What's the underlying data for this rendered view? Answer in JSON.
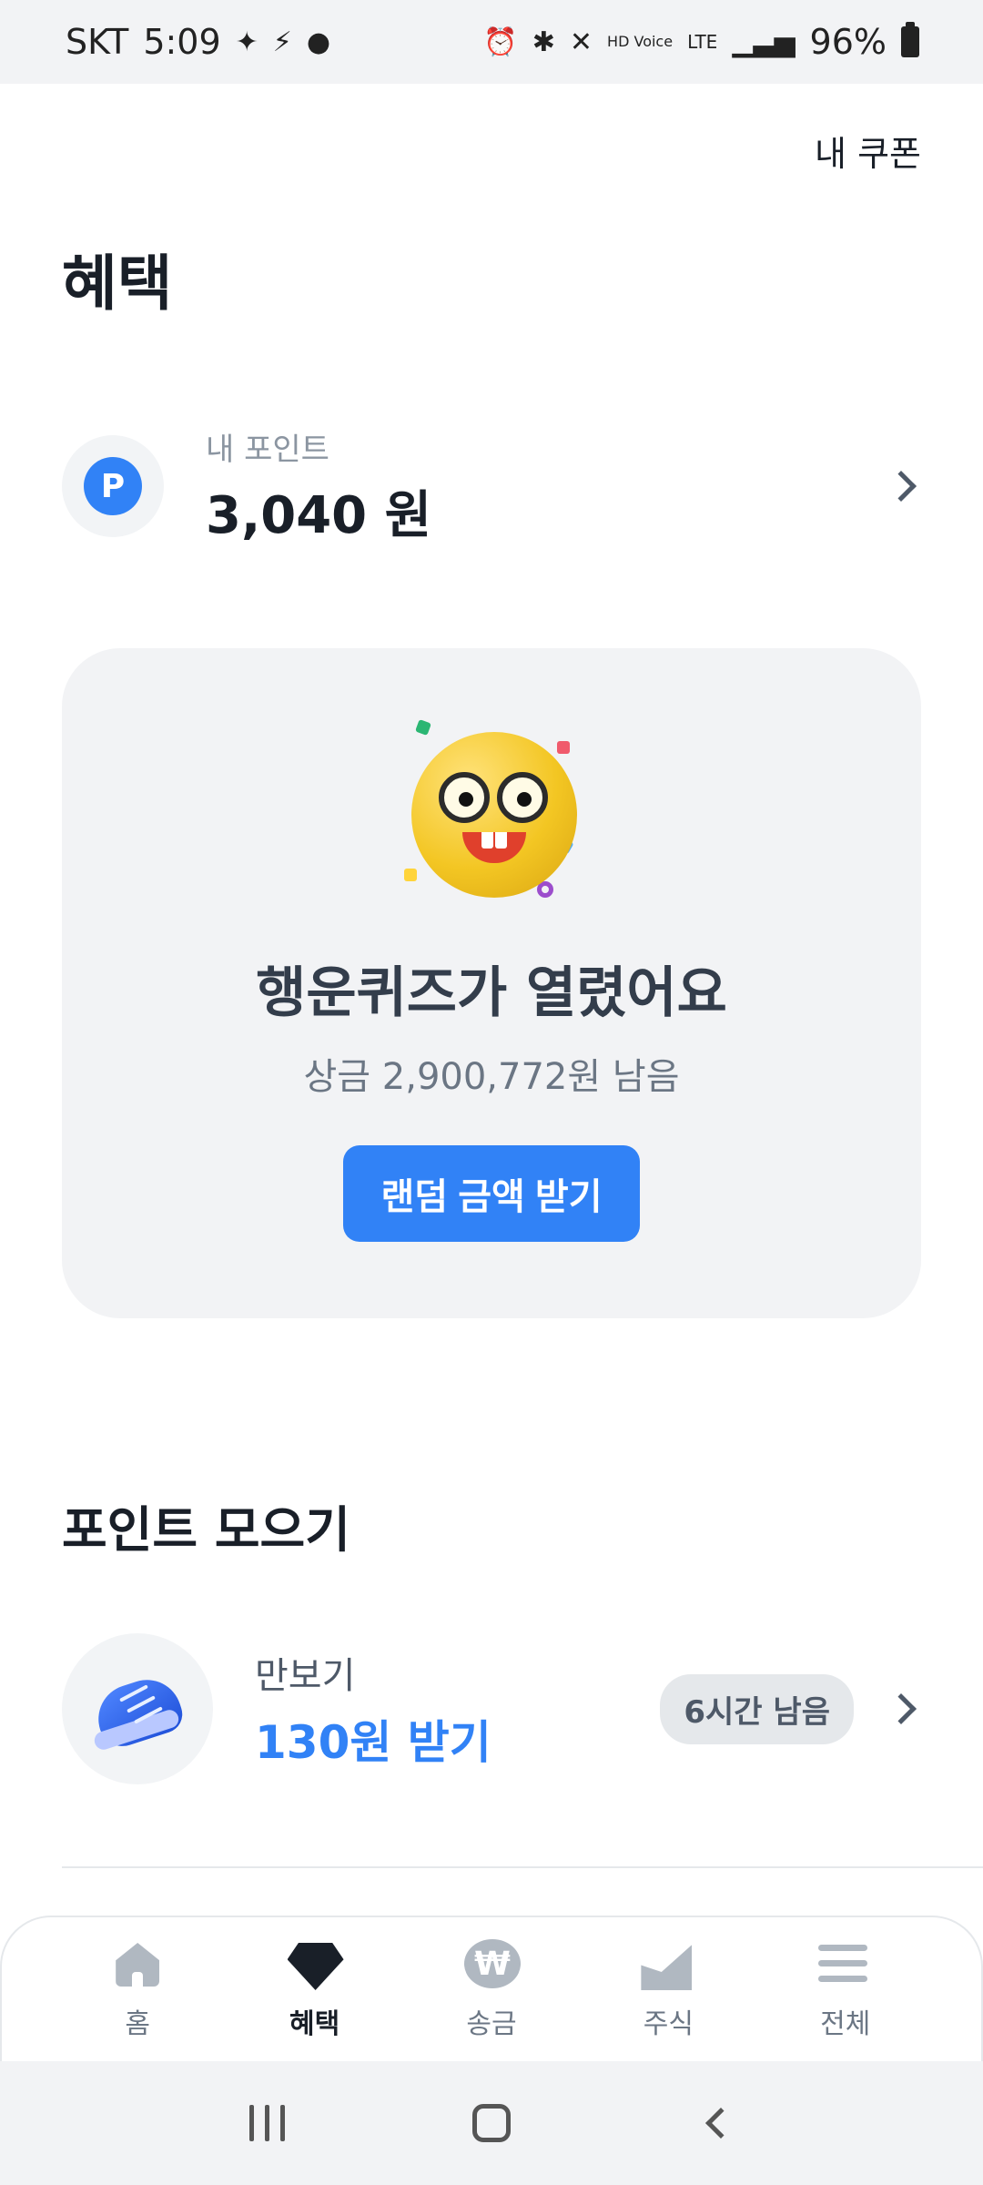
{
  "status_bar": {
    "carrier": "SKT",
    "time": "5:09",
    "battery": "96%",
    "lte": "LTE",
    "hd_voice": "HD Voice"
  },
  "header": {
    "coupon_link": "내 쿠폰",
    "title": "혜택"
  },
  "points": {
    "badge": "P",
    "label": "내 포인트",
    "value": "3,040 원"
  },
  "quiz_card": {
    "title": "행운퀴즈가 열렸어요",
    "subtitle": "상금 2,900,772원 남음",
    "button_label": "랜덤 금액 받기",
    "button_color": "#3182f6"
  },
  "collect_section": {
    "title": "포인트 모으기",
    "items": [
      {
        "icon": "sneaker-icon",
        "label": "만보기",
        "reward": "130원 받기",
        "time_left": "6시간 남음"
      }
    ]
  },
  "bottom_nav": {
    "items": [
      {
        "label": "홈",
        "icon": "home-icon",
        "active": false
      },
      {
        "label": "혜택",
        "icon": "gem-icon",
        "active": true
      },
      {
        "label": "송금",
        "icon": "won-icon",
        "active": false
      },
      {
        "label": "주식",
        "icon": "stock-chart-icon",
        "active": false
      },
      {
        "label": "전체",
        "icon": "menu-icon",
        "active": false
      }
    ]
  },
  "colors": {
    "accent": "#3182f6",
    "text_primary": "#191f28",
    "card_bg": "#f2f3f5"
  }
}
